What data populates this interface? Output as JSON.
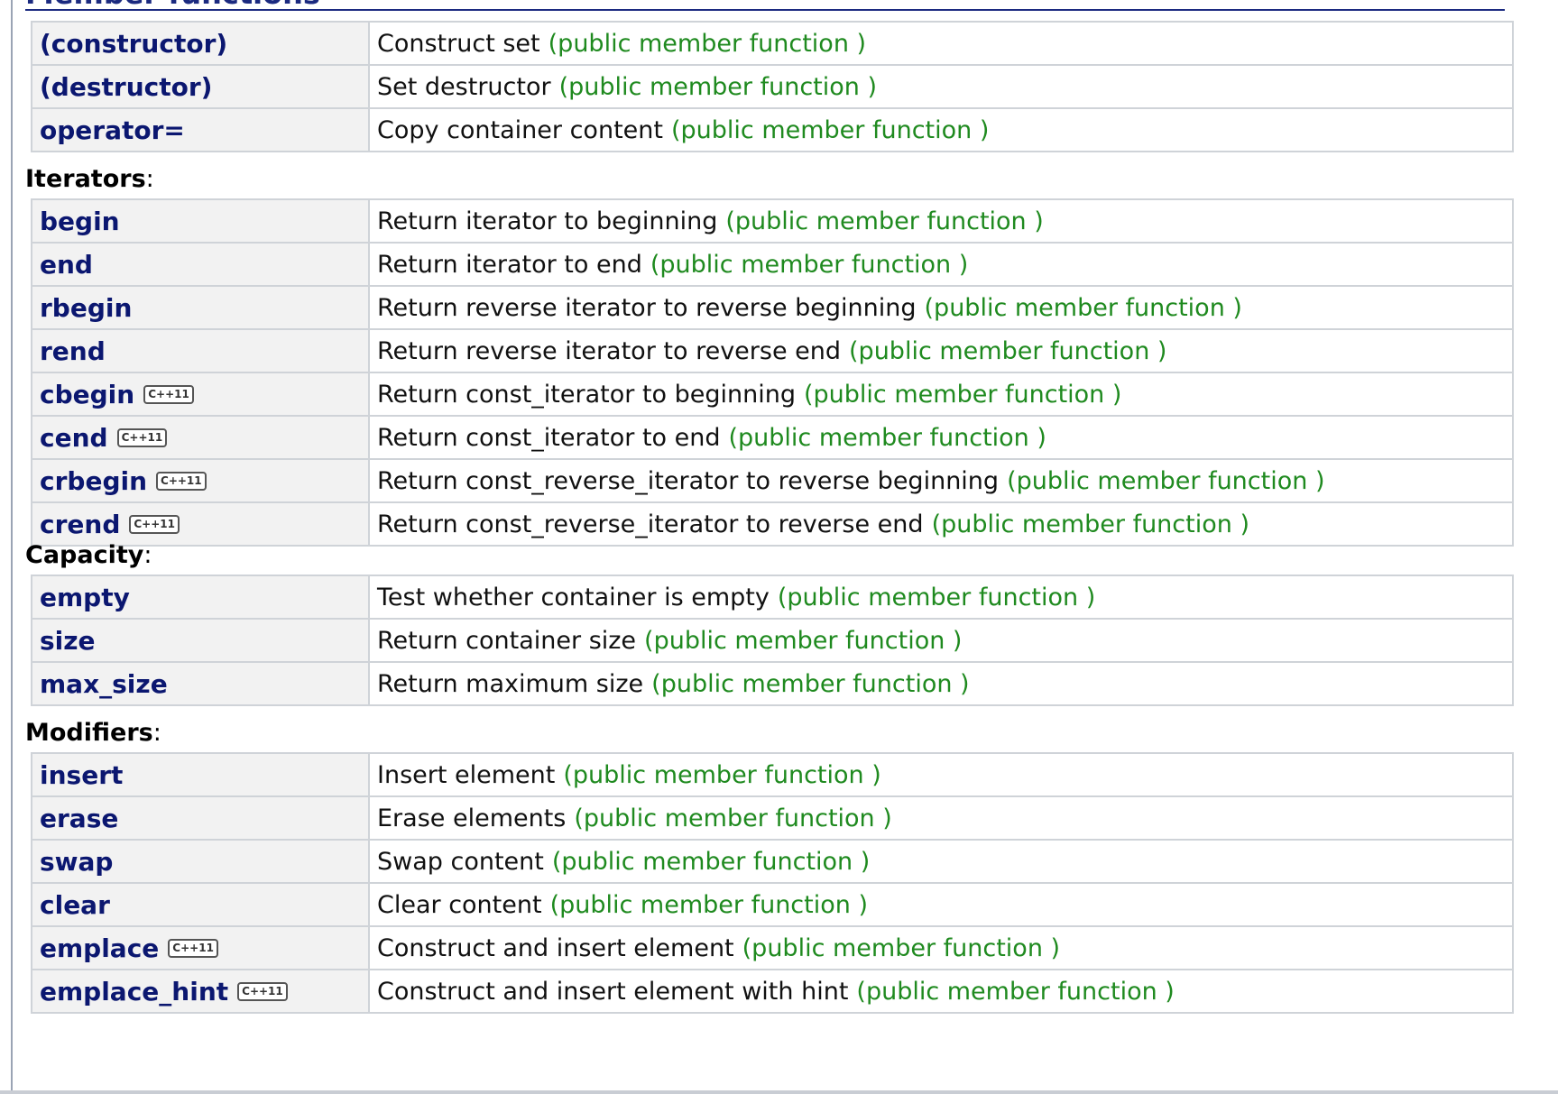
{
  "header": {
    "partial_title": "Member functions"
  },
  "kind_label": "(public member function )",
  "badge_label": "C++11",
  "groups": [
    {
      "title": "",
      "rows": [
        {
          "name": "(constructor)",
          "desc": "Construct set",
          "badge": false
        },
        {
          "name": "(destructor)",
          "desc": "Set destructor",
          "badge": false
        },
        {
          "name": "operator=",
          "desc": "Copy container content",
          "badge": false
        }
      ]
    },
    {
      "title": "Iterators",
      "rows": [
        {
          "name": "begin",
          "desc": "Return iterator to beginning",
          "badge": false
        },
        {
          "name": "end",
          "desc": "Return iterator to end",
          "badge": false
        },
        {
          "name": "rbegin",
          "desc": "Return reverse iterator to reverse beginning",
          "badge": false
        },
        {
          "name": "rend",
          "desc": "Return reverse iterator to reverse end",
          "badge": false
        },
        {
          "name": "cbegin",
          "desc": "Return const_iterator to beginning",
          "badge": true
        },
        {
          "name": "cend",
          "desc": "Return const_iterator to end",
          "badge": true
        },
        {
          "name": "crbegin",
          "desc": "Return const_reverse_iterator to reverse beginning",
          "badge": true
        },
        {
          "name": "crend",
          "desc": "Return const_reverse_iterator to reverse end",
          "badge": true
        }
      ]
    },
    {
      "title": "Capacity",
      "rows": [
        {
          "name": "empty",
          "desc": "Test whether container is empty",
          "badge": false
        },
        {
          "name": "size",
          "desc": "Return container size",
          "badge": false
        },
        {
          "name": "max_size",
          "desc": "Return maximum size",
          "badge": false
        }
      ]
    },
    {
      "title": "Modifiers",
      "rows": [
        {
          "name": "insert",
          "desc": "Insert element",
          "badge": false
        },
        {
          "name": "erase",
          "desc": "Erase elements",
          "badge": false
        },
        {
          "name": "swap",
          "desc": "Swap content",
          "badge": false
        },
        {
          "name": "clear",
          "desc": "Clear content",
          "badge": false
        },
        {
          "name": "emplace",
          "desc": "Construct and insert element",
          "badge": true
        },
        {
          "name": "emplace_hint",
          "desc": "Construct and insert element with hint",
          "badge": true
        }
      ]
    }
  ],
  "colors": {
    "name_text": "#0b1770",
    "kind_text": "#1f8a1f",
    "name_cell_bg": "#f2f2f2",
    "border": "#cfd3d8"
  }
}
